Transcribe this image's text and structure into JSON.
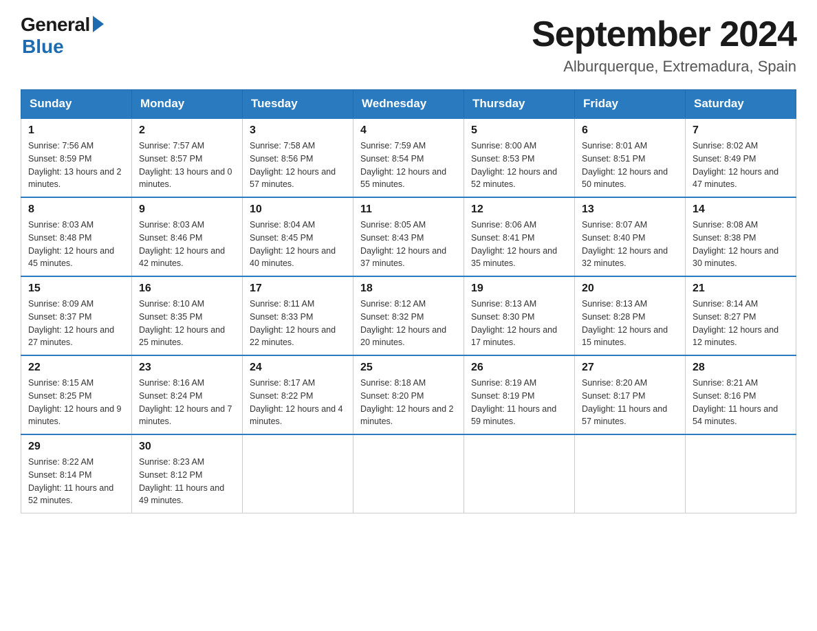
{
  "logo": {
    "general": "General",
    "blue": "Blue"
  },
  "title": "September 2024",
  "location": "Alburquerque, Extremadura, Spain",
  "weekdays": [
    "Sunday",
    "Monday",
    "Tuesday",
    "Wednesday",
    "Thursday",
    "Friday",
    "Saturday"
  ],
  "weeks": [
    [
      {
        "day": "1",
        "sunrise": "7:56 AM",
        "sunset": "8:59 PM",
        "daylight": "13 hours and 2 minutes."
      },
      {
        "day": "2",
        "sunrise": "7:57 AM",
        "sunset": "8:57 PM",
        "daylight": "13 hours and 0 minutes."
      },
      {
        "day": "3",
        "sunrise": "7:58 AM",
        "sunset": "8:56 PM",
        "daylight": "12 hours and 57 minutes."
      },
      {
        "day": "4",
        "sunrise": "7:59 AM",
        "sunset": "8:54 PM",
        "daylight": "12 hours and 55 minutes."
      },
      {
        "day": "5",
        "sunrise": "8:00 AM",
        "sunset": "8:53 PM",
        "daylight": "12 hours and 52 minutes."
      },
      {
        "day": "6",
        "sunrise": "8:01 AM",
        "sunset": "8:51 PM",
        "daylight": "12 hours and 50 minutes."
      },
      {
        "day": "7",
        "sunrise": "8:02 AM",
        "sunset": "8:49 PM",
        "daylight": "12 hours and 47 minutes."
      }
    ],
    [
      {
        "day": "8",
        "sunrise": "8:03 AM",
        "sunset": "8:48 PM",
        "daylight": "12 hours and 45 minutes."
      },
      {
        "day": "9",
        "sunrise": "8:03 AM",
        "sunset": "8:46 PM",
        "daylight": "12 hours and 42 minutes."
      },
      {
        "day": "10",
        "sunrise": "8:04 AM",
        "sunset": "8:45 PM",
        "daylight": "12 hours and 40 minutes."
      },
      {
        "day": "11",
        "sunrise": "8:05 AM",
        "sunset": "8:43 PM",
        "daylight": "12 hours and 37 minutes."
      },
      {
        "day": "12",
        "sunrise": "8:06 AM",
        "sunset": "8:41 PM",
        "daylight": "12 hours and 35 minutes."
      },
      {
        "day": "13",
        "sunrise": "8:07 AM",
        "sunset": "8:40 PM",
        "daylight": "12 hours and 32 minutes."
      },
      {
        "day": "14",
        "sunrise": "8:08 AM",
        "sunset": "8:38 PM",
        "daylight": "12 hours and 30 minutes."
      }
    ],
    [
      {
        "day": "15",
        "sunrise": "8:09 AM",
        "sunset": "8:37 PM",
        "daylight": "12 hours and 27 minutes."
      },
      {
        "day": "16",
        "sunrise": "8:10 AM",
        "sunset": "8:35 PM",
        "daylight": "12 hours and 25 minutes."
      },
      {
        "day": "17",
        "sunrise": "8:11 AM",
        "sunset": "8:33 PM",
        "daylight": "12 hours and 22 minutes."
      },
      {
        "day": "18",
        "sunrise": "8:12 AM",
        "sunset": "8:32 PM",
        "daylight": "12 hours and 20 minutes."
      },
      {
        "day": "19",
        "sunrise": "8:13 AM",
        "sunset": "8:30 PM",
        "daylight": "12 hours and 17 minutes."
      },
      {
        "day": "20",
        "sunrise": "8:13 AM",
        "sunset": "8:28 PM",
        "daylight": "12 hours and 15 minutes."
      },
      {
        "day": "21",
        "sunrise": "8:14 AM",
        "sunset": "8:27 PM",
        "daylight": "12 hours and 12 minutes."
      }
    ],
    [
      {
        "day": "22",
        "sunrise": "8:15 AM",
        "sunset": "8:25 PM",
        "daylight": "12 hours and 9 minutes."
      },
      {
        "day": "23",
        "sunrise": "8:16 AM",
        "sunset": "8:24 PM",
        "daylight": "12 hours and 7 minutes."
      },
      {
        "day": "24",
        "sunrise": "8:17 AM",
        "sunset": "8:22 PM",
        "daylight": "12 hours and 4 minutes."
      },
      {
        "day": "25",
        "sunrise": "8:18 AM",
        "sunset": "8:20 PM",
        "daylight": "12 hours and 2 minutes."
      },
      {
        "day": "26",
        "sunrise": "8:19 AM",
        "sunset": "8:19 PM",
        "daylight": "11 hours and 59 minutes."
      },
      {
        "day": "27",
        "sunrise": "8:20 AM",
        "sunset": "8:17 PM",
        "daylight": "11 hours and 57 minutes."
      },
      {
        "day": "28",
        "sunrise": "8:21 AM",
        "sunset": "8:16 PM",
        "daylight": "11 hours and 54 minutes."
      }
    ],
    [
      {
        "day": "29",
        "sunrise": "8:22 AM",
        "sunset": "8:14 PM",
        "daylight": "11 hours and 52 minutes."
      },
      {
        "day": "30",
        "sunrise": "8:23 AM",
        "sunset": "8:12 PM",
        "daylight": "11 hours and 49 minutes."
      },
      null,
      null,
      null,
      null,
      null
    ]
  ]
}
